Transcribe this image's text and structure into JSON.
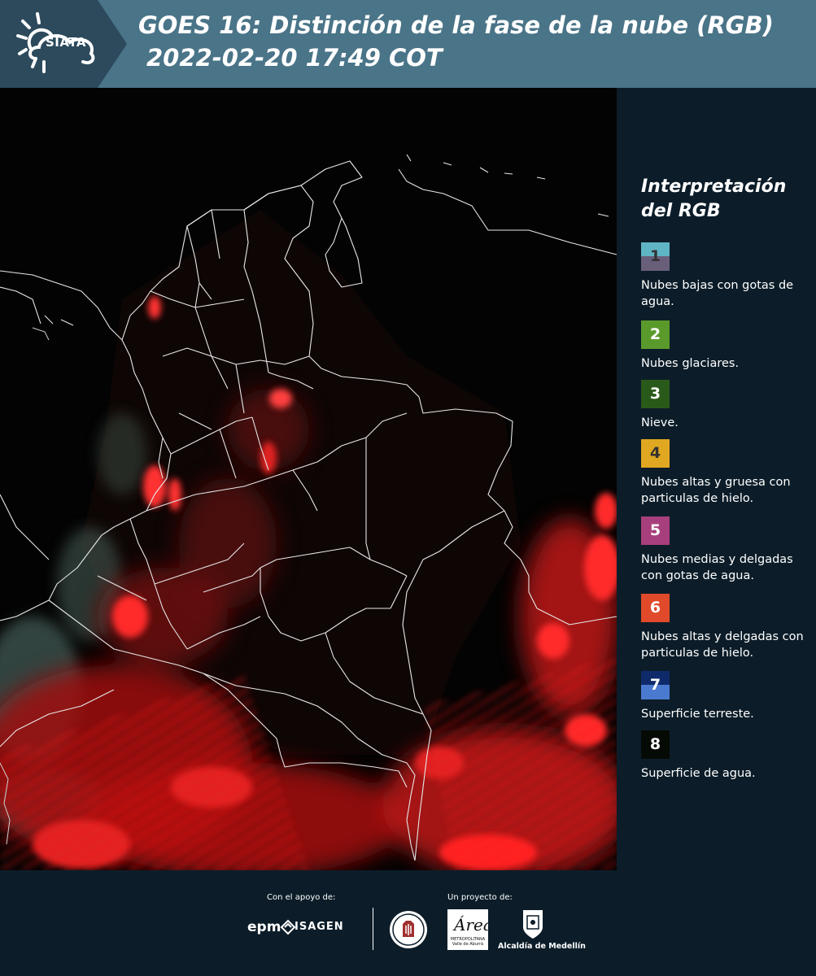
{
  "header": {
    "logo_text": "SIATA",
    "title_line1": "GOES 16: Distinción de la fase de la nube (RGB)",
    "title_line2": "2022-02-20 17:49 COT"
  },
  "legend": {
    "title": "Interpretación del RGB",
    "items": [
      {
        "num": "1",
        "text": "Nubes bajas con gotas de agua.",
        "top": "#5fb5c4",
        "bottom": "#6a5f7b",
        "num_color": "#333333"
      },
      {
        "num": "2",
        "text": "Nubes glaciares.",
        "top": "#5a9a2b",
        "bottom": "#5a9a2b",
        "num_color": "#ffffff"
      },
      {
        "num": "3",
        "text": "Nieve.",
        "top": "#2a5a1a",
        "bottom": "#2a5a1a",
        "num_color": "#ffffff"
      },
      {
        "num": "4",
        "text": "Nubes altas y gruesa con particulas de hielo.",
        "top": "#e0a820",
        "bottom": "#e0a820",
        "num_color": "#333333"
      },
      {
        "num": "5",
        "text": "Nubes medias y delgadas con gotas de agua.",
        "top": "#a83f7d",
        "bottom": "#a83f7d",
        "num_color": "#ffffff"
      },
      {
        "num": "6",
        "text": "Nubes altas y delgadas con particulas de hielo.",
        "top": "#e04a2a",
        "bottom": "#e04a2a",
        "num_color": "#ffffff"
      },
      {
        "num": "7",
        "text": "Superficie terreste.",
        "top": "#0f2a6a",
        "bottom": "#4a7ad0",
        "num_color": "#ffffff"
      },
      {
        "num": "8",
        "text": "Superficie de agua.",
        "top": "#050a05",
        "bottom": "#050a05",
        "num_color": "#ffffff"
      }
    ]
  },
  "footer": {
    "support_label": "Con el apoyo de:",
    "project_label": "Un proyecto de:",
    "epm": "epm",
    "isagen": "ISAGEN",
    "area_metro": "METROPOLITANA",
    "area_valle": "Valle de Aburrá",
    "alcaldia": "Alcaldía de Medellín"
  },
  "colors": {
    "header_bg": "#4a7488",
    "logo_bg": "#2c4a5c",
    "panel_bg": "#0c1d29",
    "cloud_red": "#e01010"
  }
}
